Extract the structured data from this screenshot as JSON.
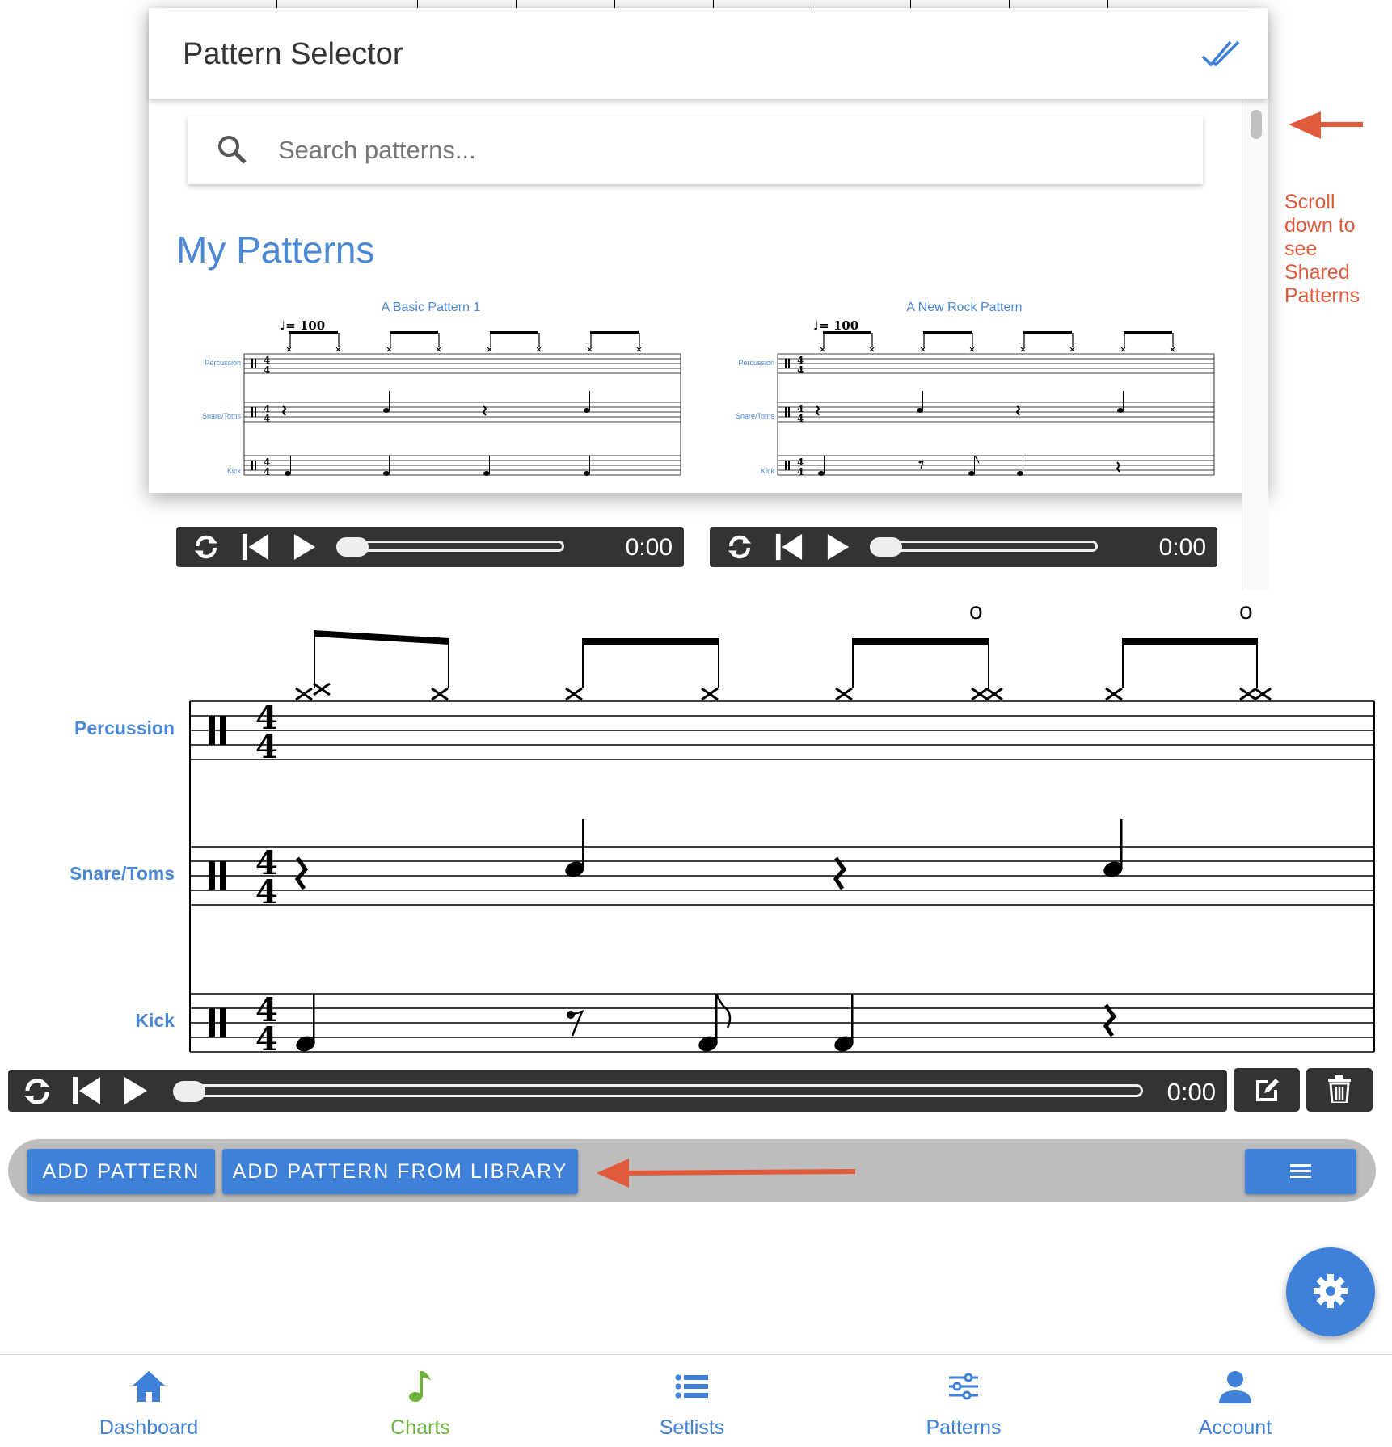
{
  "dialog": {
    "title": "Pattern Selector",
    "done_icon": "double-check-icon",
    "search": {
      "placeholder": "Search patterns...",
      "value": ""
    },
    "section_title": "My Patterns",
    "patterns": [
      {
        "title": "A Basic Pattern 1",
        "tempo": "= 100",
        "instruments": [
          "Percussion",
          "Snare/Toms",
          "Kick"
        ],
        "time": "0:00"
      },
      {
        "title": "A New Rock Pattern",
        "tempo": "= 100",
        "instruments": [
          "Percussion",
          "Snare/Toms",
          "Kick"
        ],
        "time": "0:00"
      }
    ]
  },
  "annotation": {
    "text": [
      "Scroll",
      "down to",
      "see",
      "Shared",
      "Patterns"
    ],
    "color": "#e05b3c"
  },
  "main_score": {
    "staves": [
      "Percussion",
      "Snare/Toms",
      "Kick"
    ],
    "open_hihat_marks": [
      "o",
      "o"
    ]
  },
  "main_player": {
    "time": "0:00",
    "icons": [
      "loop-icon",
      "skip-back-icon",
      "play-icon"
    ]
  },
  "toolbar": {
    "add_pattern": "ADD PATTERN",
    "add_from_library": "ADD PATTERN FROM LIBRARY",
    "menu_icon": "menu-icon"
  },
  "bottom_nav": [
    {
      "label": "Dashboard",
      "icon": "home-icon",
      "color": "#3f80d8"
    },
    {
      "label": "Charts",
      "icon": "music-note-icon",
      "color": "#6cb33f"
    },
    {
      "label": "Setlists",
      "icon": "list-icon",
      "color": "#3f80d8"
    },
    {
      "label": "Patterns",
      "icon": "sliders-icon",
      "color": "#3f80d8"
    },
    {
      "label": "Account",
      "icon": "person-icon",
      "color": "#3f80d8"
    }
  ],
  "colors": {
    "accent": "#3f80d8",
    "title_blue": "#4a88d6",
    "player_bg": "#333333",
    "annotation": "#e05b3c"
  }
}
